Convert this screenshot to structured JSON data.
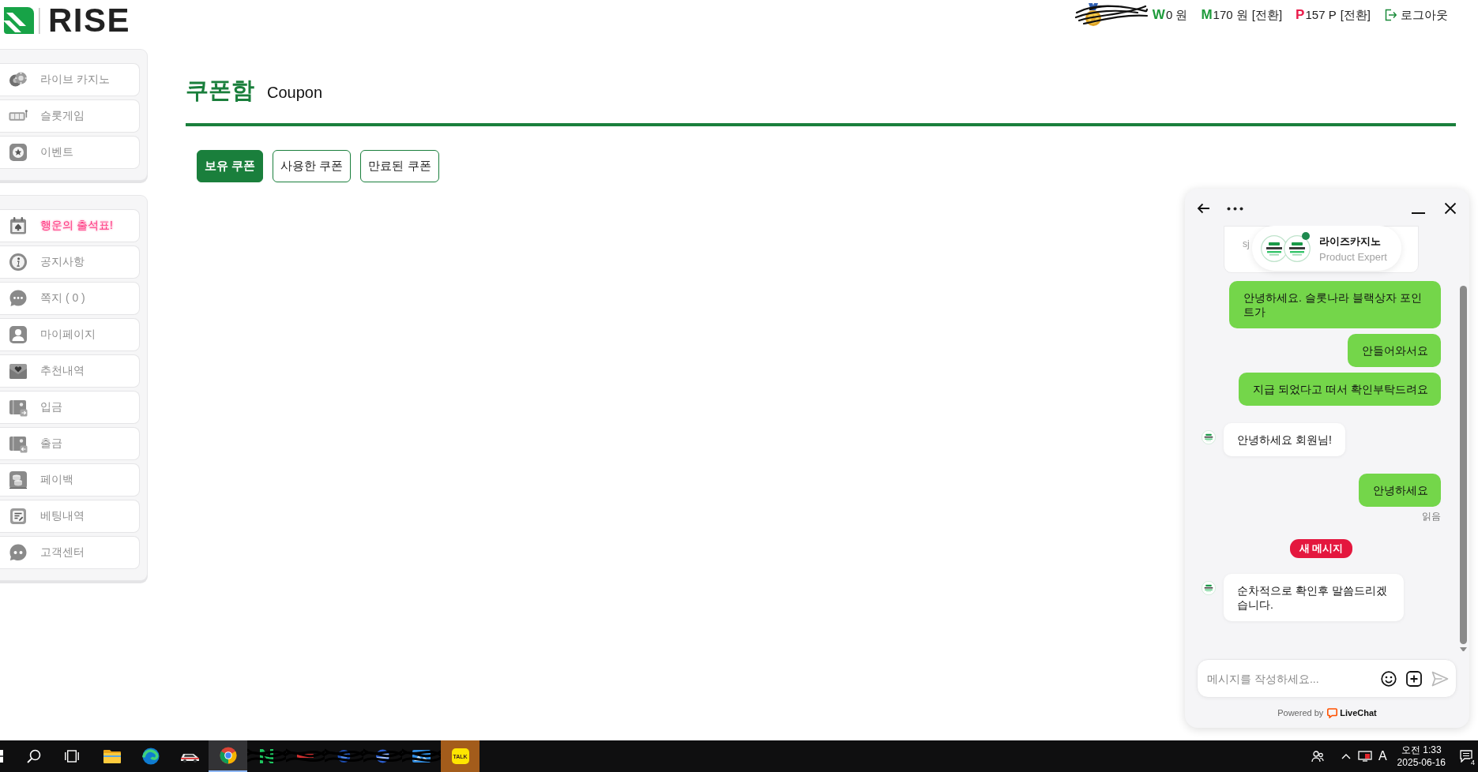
{
  "header": {
    "logo": {
      "text": "RISE"
    },
    "wallet": [
      {
        "symbol": "W",
        "amount": "0 원",
        "color": "#1e9b3b"
      },
      {
        "symbol": "M",
        "amount": "170 원",
        "action": "[전환]",
        "color": "#1e9b3b"
      },
      {
        "symbol": "P",
        "amount": "157 P",
        "action": "[전환]",
        "color": "#ea1b4b"
      }
    ],
    "logout": {
      "label": "로그아웃"
    }
  },
  "sidebar": {
    "groups": [
      {
        "items": [
          {
            "label": "라이브 카지노",
            "kind": "link"
          },
          {
            "label": "슬롯게임",
            "kind": "link"
          },
          {
            "label": "이벤트",
            "kind": "link"
          }
        ]
      },
      {
        "items": [
          {
            "label": "행운의 출석표!",
            "kind": "promo"
          },
          {
            "label": "공지사항",
            "kind": "link"
          },
          {
            "label": "쪽지 ( 0 )",
            "kind": "link"
          },
          {
            "label": "마이페이지",
            "kind": "link"
          },
          {
            "label": "추천내역",
            "kind": "link"
          },
          {
            "label": "입금",
            "kind": "link"
          },
          {
            "label": "출금",
            "kind": "link"
          },
          {
            "label": "페이백",
            "kind": "link"
          },
          {
            "label": "베팅내역",
            "kind": "link"
          },
          {
            "label": "고객센터",
            "kind": "link"
          }
        ]
      }
    ]
  },
  "page": {
    "title": "쿠폰함",
    "subtitle": "Coupon",
    "tabs": [
      {
        "label": "보유 쿠폰",
        "selected": true
      },
      {
        "label": "사용한 쿠폰",
        "selected": false
      },
      {
        "label": "만료된 쿠폰",
        "selected": false
      }
    ]
  },
  "chat": {
    "agent": {
      "name": "라이즈카지노",
      "role": "Product Expert",
      "online": true
    },
    "previous_card": {
      "text": "sj"
    },
    "messages": [
      {
        "kind": "visitor",
        "text": "안녕하세요. 슬롯나라 블랙상자 포인트가"
      },
      {
        "kind": "visitor",
        "text": "안들어와서요"
      },
      {
        "kind": "visitor",
        "text": "지급 되었다고 떠서 확인부탁드려요"
      },
      {
        "kind": "agent",
        "text": "안녕하세요 회원님!"
      },
      {
        "kind": "visitor",
        "text": "안녕하세요",
        "status": "읽음"
      },
      {
        "kind": "divider",
        "text": "새 메시지"
      },
      {
        "kind": "agent",
        "text": "순차적으로 확인후 말씀드리겠습니다."
      }
    ],
    "input": {
      "placeholder": "메시지를 작성하세요..."
    },
    "footer": {
      "prefix": "Powered by",
      "brand": "LiveChat"
    }
  },
  "taskbar": {
    "apps": [
      {
        "active": false,
        "flashing": false
      },
      {
        "active": false,
        "flashing": false
      },
      {
        "active": false,
        "flashing": false
      },
      {
        "active": true,
        "flashing": false
      },
      {
        "active": false,
        "flashing": false
      },
      {
        "active": false,
        "flashing": false
      },
      {
        "active": false,
        "flashing": false
      },
      {
        "active": false,
        "flashing": false
      },
      {
        "active": false,
        "flashing": false
      },
      {
        "label": "TALK",
        "active": false,
        "flashing": true
      }
    ],
    "ime": "A",
    "clock": {
      "time": "오전 1:33",
      "date": "2025-06-16"
    },
    "notifications": "4"
  }
}
